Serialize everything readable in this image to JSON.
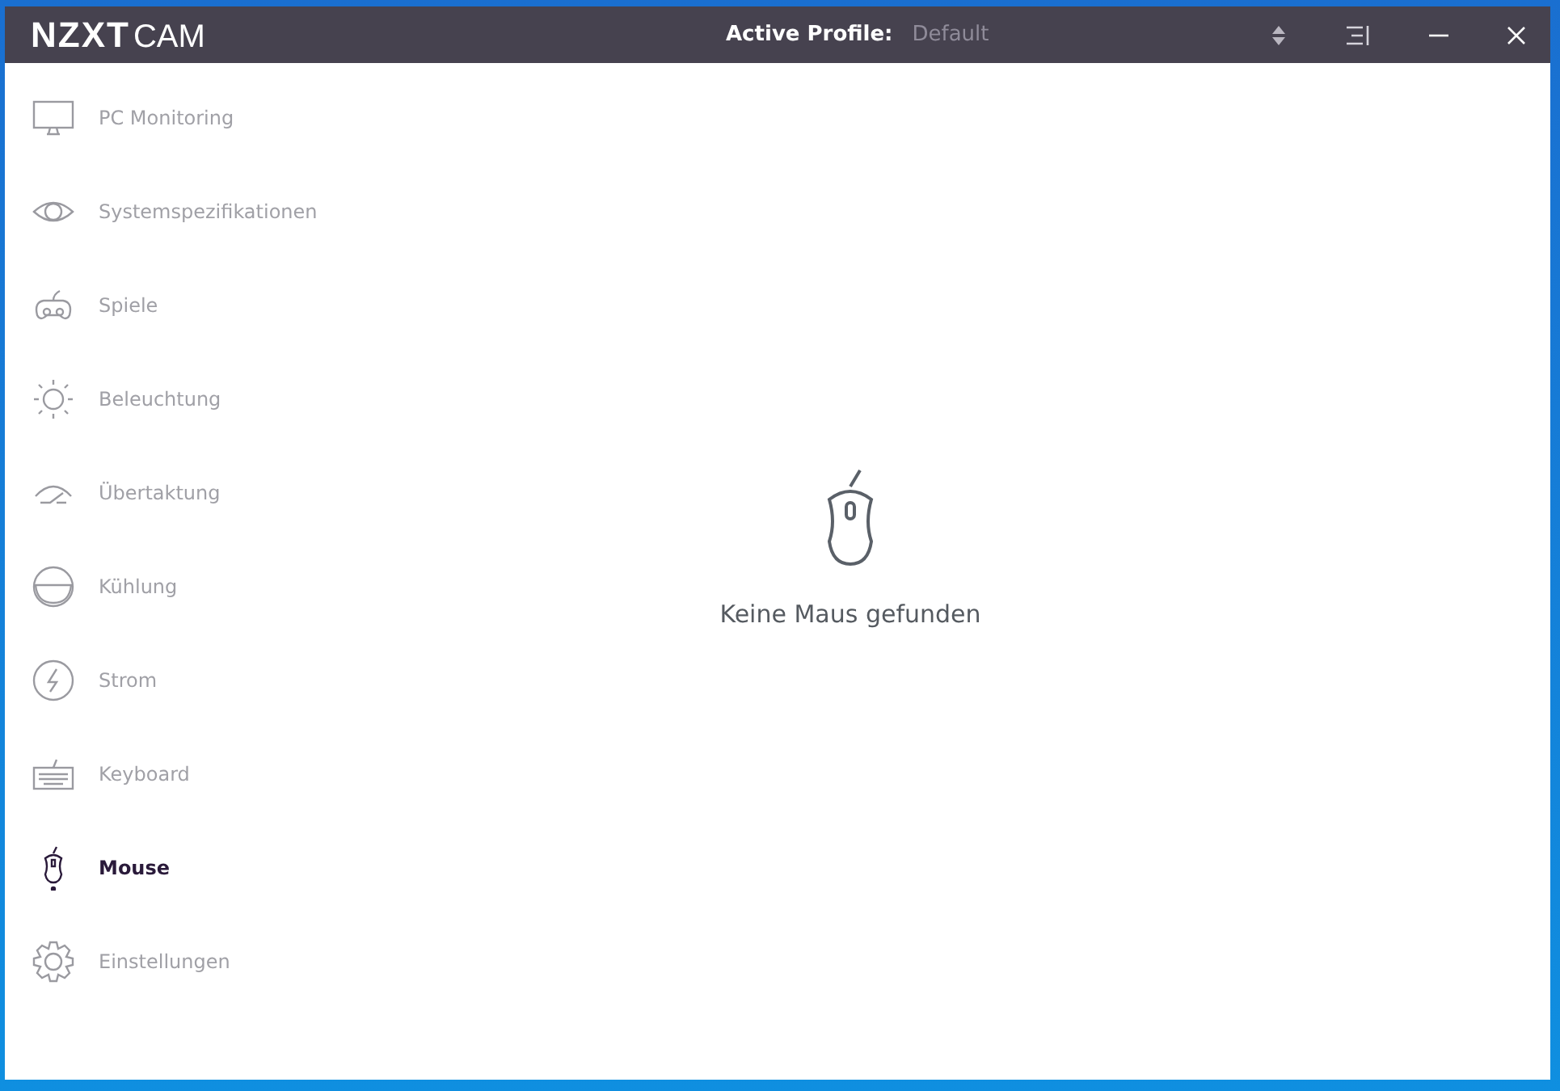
{
  "window": {
    "logo_bold": "NZXT",
    "logo_light": "CAM",
    "profile_label": "Active Profile:",
    "profile_value": "Default"
  },
  "sidebar": {
    "items": [
      {
        "label": "PC Monitoring",
        "kind": "monitor",
        "selected": false
      },
      {
        "label": "Systemspezifikationen",
        "kind": "eye",
        "selected": false
      },
      {
        "label": "Spiele",
        "kind": "gamepad",
        "selected": false
      },
      {
        "label": "Beleuchtung",
        "kind": "sun",
        "selected": false
      },
      {
        "label": "Übertaktung",
        "kind": "gauge",
        "selected": false
      },
      {
        "label": "Kühlung",
        "kind": "cooling",
        "selected": false
      },
      {
        "label": "Strom",
        "kind": "power",
        "selected": false
      },
      {
        "label": "Keyboard",
        "kind": "keyboard",
        "selected": false
      },
      {
        "label": "Mouse",
        "kind": "mouse",
        "selected": true
      },
      {
        "label": "Einstellungen",
        "kind": "gear",
        "selected": false
      }
    ]
  },
  "main": {
    "message": "Keine Maus gefunden"
  }
}
